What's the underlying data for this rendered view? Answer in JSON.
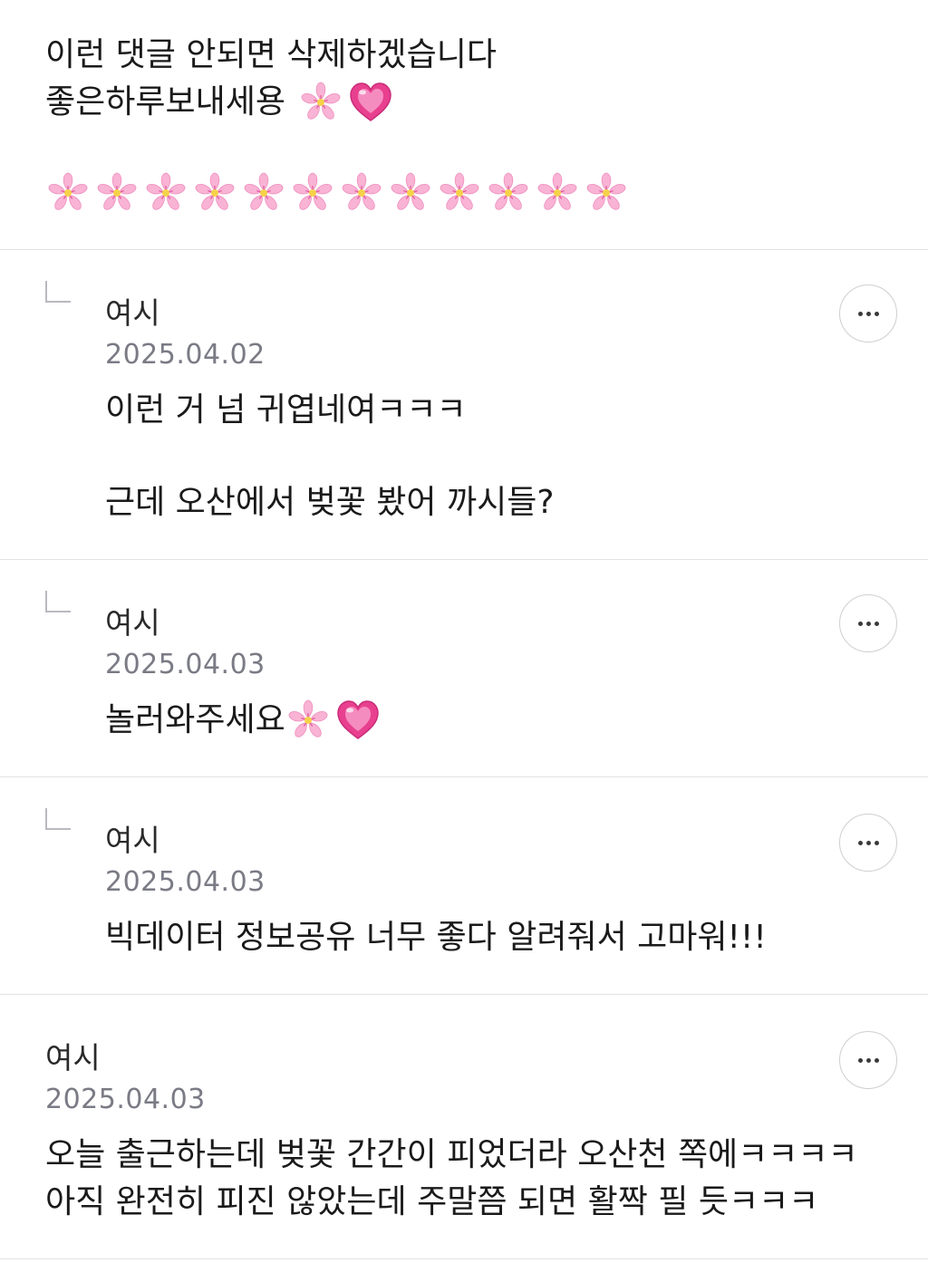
{
  "post": {
    "line1": "이런 댓글 안되면 삭제하겠습니다",
    "line2": "좋은하루보내세용",
    "line2_emojis": [
      "cherry-blossom",
      "heart"
    ],
    "flower_row_count": 12,
    "flower_row_emoji": "cherry-blossom"
  },
  "comments": [
    {
      "author": "여시",
      "date": "2025.04.02",
      "is_reply": true,
      "line1": "이런 거 넘 귀엽네여ㅋㅋㅋ",
      "line2": "",
      "line3": "근데 오산에서 벚꽃 봤어 까시들?"
    },
    {
      "author": "여시",
      "date": "2025.04.03",
      "is_reply": true,
      "line1": "놀러와주세요",
      "emojis": [
        "cherry-blossom",
        "heart"
      ]
    },
    {
      "author": "여시",
      "date": "2025.04.03",
      "is_reply": true,
      "line1": "빅데이터 정보공유 너무 좋다 알려줘서 고마워!!!"
    },
    {
      "author": "여시",
      "date": "2025.04.03",
      "is_reply": false,
      "line1": "오늘 출근하는데 벚꽃 간간이 피었더라 오산천 쪽에ㅋㅋㅋㅋ",
      "line2": "아직 완전히 피진 않았는데 주말쯤 되면 활짝 필 듯ㅋㅋㅋ"
    }
  ],
  "more_button_label": "•••",
  "colors": {
    "divider": "#e2e2e6",
    "date": "#7a7b85",
    "text": "#1a1a1a",
    "flower": "#f7a8cf",
    "heart": "#e8408f"
  }
}
